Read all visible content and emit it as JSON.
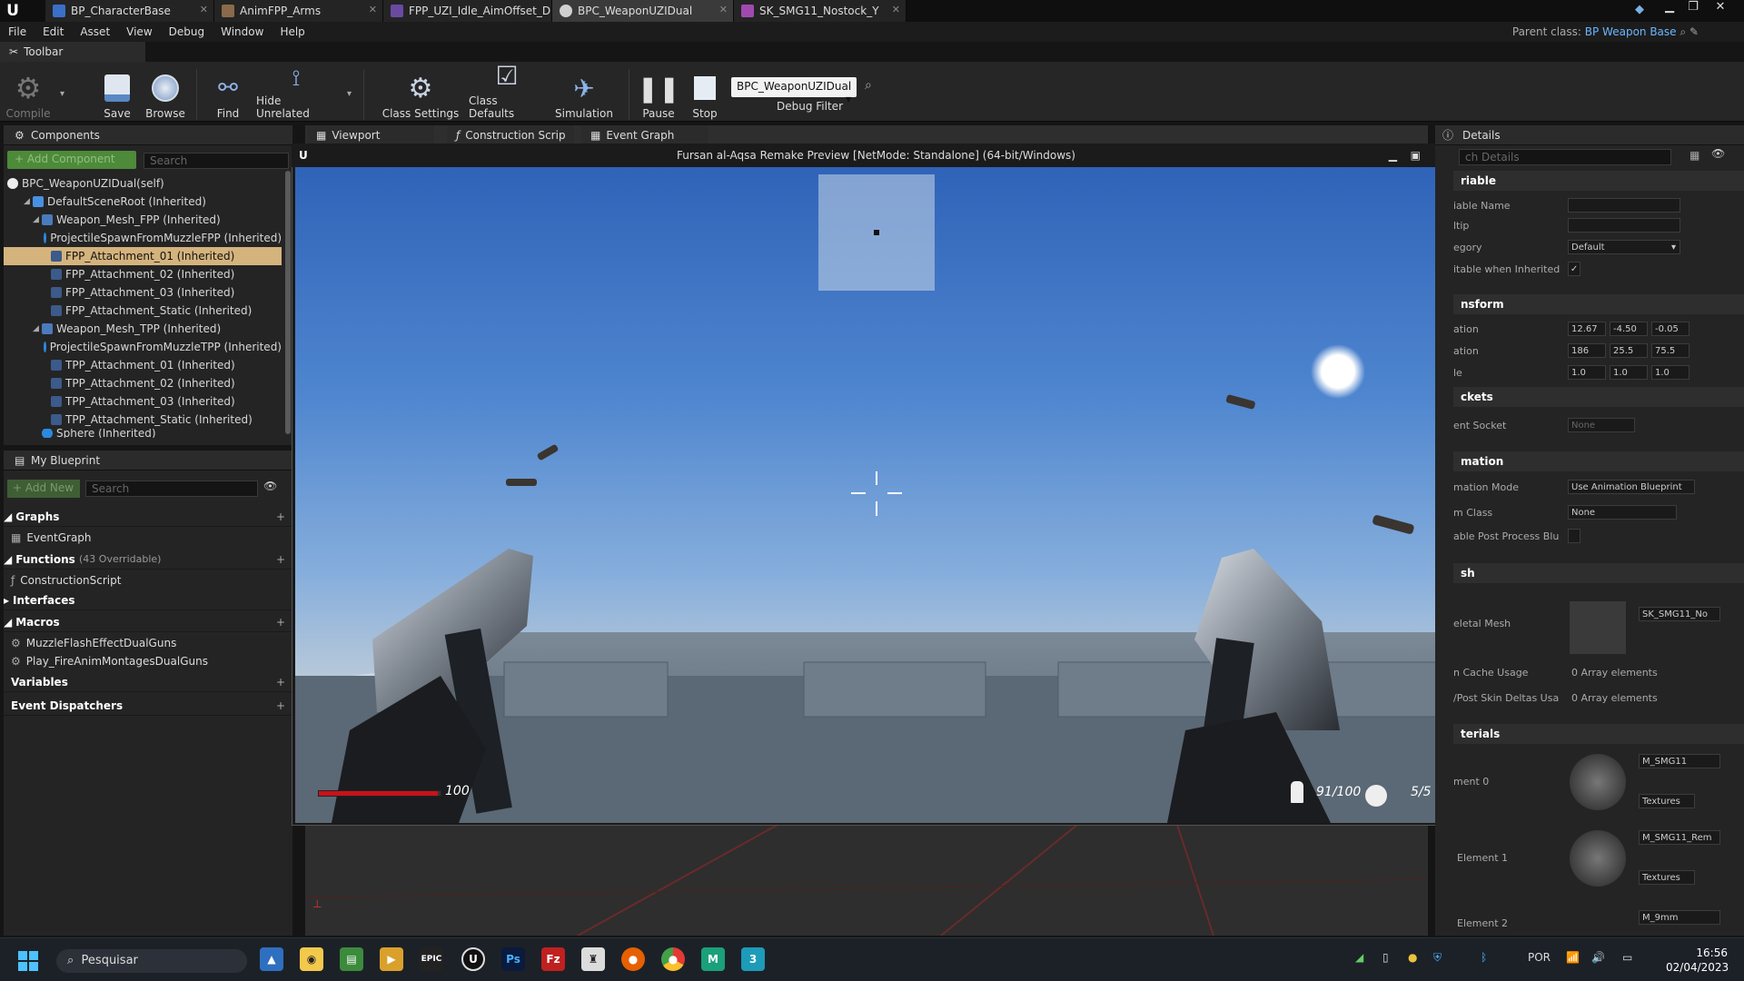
{
  "tabs": [
    {
      "label": "BP_CharacterBase",
      "color": "#3a70c8"
    },
    {
      "label": "AnimFPP_Arms",
      "color": "#8a6a4a"
    },
    {
      "label": "FPP_UZI_Idle_AimOffset_D",
      "color": "#6a4aa0"
    },
    {
      "label": "BPC_WeaponUZIDual",
      "color": "#d0d0d0"
    },
    {
      "label": "SK_SMG11_Nostock_Y",
      "color": "#a04ab0"
    }
  ],
  "menu": [
    "File",
    "Edit",
    "Asset",
    "View",
    "Debug",
    "Window",
    "Help"
  ],
  "parent_class_label": "Parent class:",
  "parent_class_value": "BP Weapon Base",
  "toolbar_title": "Toolbar",
  "toolbar": {
    "compile": "Compile",
    "save": "Save",
    "browse": "Browse",
    "find": "Find",
    "hide_unrelated": "Hide Unrelated",
    "class_settings": "Class Settings",
    "class_defaults": "Class Defaults",
    "simulation": "Simulation",
    "pause": "Pause",
    "stop": "Stop",
    "debug_select": "BPC_WeaponUZIDual",
    "debug_filter": "Debug Filter"
  },
  "components": {
    "title": "Components",
    "add_button": "+ Add Component",
    "search_placeholder": "Search",
    "self": "BPC_WeaponUZIDual(self)",
    "items": [
      "DefaultSceneRoot (Inherited)",
      "Weapon_Mesh_FPP (Inherited)",
      "ProjectileSpawnFromMuzzleFPP (Inherited)",
      "FPP_Attachment_01 (Inherited)",
      "FPP_Attachment_02 (Inherited)",
      "FPP_Attachment_03 (Inherited)",
      "FPP_Attachment_Static (Inherited)",
      "Weapon_Mesh_TPP (Inherited)",
      "ProjectileSpawnFromMuzzleTPP (Inherited)",
      "TPP_Attachment_01 (Inherited)",
      "TPP_Attachment_02 (Inherited)",
      "TPP_Attachment_03 (Inherited)",
      "TPP_Attachment_Static (Inherited)",
      "Sphere (Inherited)"
    ]
  },
  "my_blueprint": {
    "title": "My Blueprint",
    "add_new": "+ Add New",
    "search_placeholder": "Search",
    "graphs": "Graphs",
    "event_graph": "EventGraph",
    "functions": "Functions",
    "functions_count": "(43 Overridable)",
    "construction_script": "ConstructionScript",
    "interfaces": "Interfaces",
    "macros": "Macros",
    "macro_items": [
      "MuzzleFlashEffectDualGuns",
      "Play_FireAnimMontagesDualGuns"
    ],
    "variables": "Variables",
    "event_dispatchers": "Event Dispatchers"
  },
  "center_tabs": [
    "Viewport",
    "Construction Scrip",
    "Event Graph"
  ],
  "game_window_title": "Fursan al-Aqsa Remake Preview [NetMode: Standalone]  (64-bit/Windows)",
  "hud": {
    "health_value": 0.98,
    "health_text": "100",
    "ammo": "91/100",
    "grenades": "5/5"
  },
  "details": {
    "title": "Details",
    "search_placeholder": "ch Details",
    "sections": {
      "variable": "riable",
      "transform": "nsform",
      "sockets": "ckets",
      "animation": "mation",
      "mesh": "sh",
      "materials": "terials"
    },
    "rows": {
      "var_name": "iable Name",
      "tooltip": "ltip",
      "category": "egory",
      "category_value": "Default",
      "editable_inherited": "itable when Inherited",
      "location": "ation",
      "rotation": "ation",
      "scale": "le",
      "loc": [
        "12.67",
        "-4.50",
        "-0.05"
      ],
      "rot": [
        "186",
        "25.5",
        "75.5"
      ],
      "scl": [
        "1.0",
        "1.0",
        "1.0"
      ],
      "parent_socket": "ent Socket",
      "parent_socket_value": "None",
      "anim_mode": "mation Mode",
      "anim_mode_value": "Use Animation Blueprint",
      "anim_class": "m Class",
      "anim_class_value": "None",
      "post_process": "able Post Process Blu",
      "skeletal_mesh": "eletal Mesh",
      "skeletal_mesh_value": "SK_SMG11_No",
      "cache_usage": "n Cache Usage",
      "cache_usage_value": "0 Array elements",
      "skin_deltas": "/Post Skin Deltas Usa",
      "skin_deltas_value": "0 Array elements",
      "element0": "ment 0",
      "mat0": "M_SMG11",
      "textures": "Textures",
      "element1": "Element 1",
      "mat1": "M_SMG11_Rem",
      "element2": "Element 2",
      "mat2": "M_9mm"
    }
  },
  "taskbar": {
    "search": "Pesquisar",
    "lang": "POR",
    "time": "16:56",
    "date": "02/04/2023"
  }
}
